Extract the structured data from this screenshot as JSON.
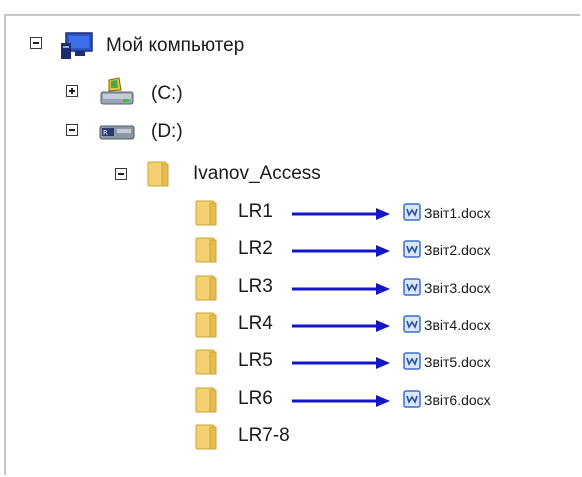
{
  "tree": {
    "root": {
      "label": "Мой компьютер",
      "expanded": true
    },
    "drive_c": {
      "label": "(C:)",
      "expanded": false
    },
    "drive_d": {
      "label": "(D:)",
      "expanded": true
    },
    "folder_main": {
      "label": "Ivanov_Access",
      "expanded": true
    },
    "lab_folders": [
      {
        "label": "LR1",
        "file": "Звіт1.docx"
      },
      {
        "label": "LR2",
        "file": "Звіт2.docx"
      },
      {
        "label": "LR3",
        "file": "Звіт3.docx"
      },
      {
        "label": "LR4",
        "file": "Звіт4.docx"
      },
      {
        "label": "LR5",
        "file": "Звіт5.docx"
      },
      {
        "label": "LR6",
        "file": "Звіт6.docx"
      },
      {
        "label": "LR7-8",
        "file": ""
      }
    ]
  },
  "colors": {
    "arrow": "#1414c8",
    "folder": "#f3d27a",
    "doc": "#3b6fc9"
  }
}
